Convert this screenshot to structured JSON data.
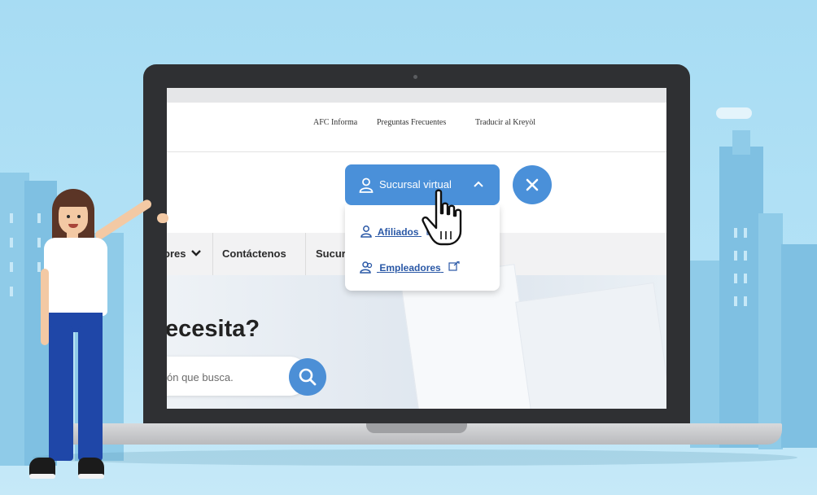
{
  "site": {
    "utility_links": [
      "AFC Informa",
      "Preguntas Frecuentes",
      "Traducir al Kreyòl"
    ],
    "nav": {
      "partial_item": "ores",
      "contact": "Contáctenos",
      "partial_sucursal": "Sucur"
    },
    "hero_title_partial": "ecesita?",
    "search_placeholder_partial": "ón que busca."
  },
  "sucursal_menu": {
    "button_label": "Sucursal virtual",
    "items": [
      {
        "label": "Afiliados"
      },
      {
        "label": "Empleadores"
      }
    ]
  },
  "colors": {
    "accent": "#4a90d9",
    "link": "#2a58a6",
    "sky": "#a7dcf3"
  },
  "icons": [
    "user-icon",
    "chevron-up-icon",
    "close-icon",
    "search-icon",
    "external-link-icon",
    "hand-cursor-icon",
    "chevron-down-icon"
  ]
}
